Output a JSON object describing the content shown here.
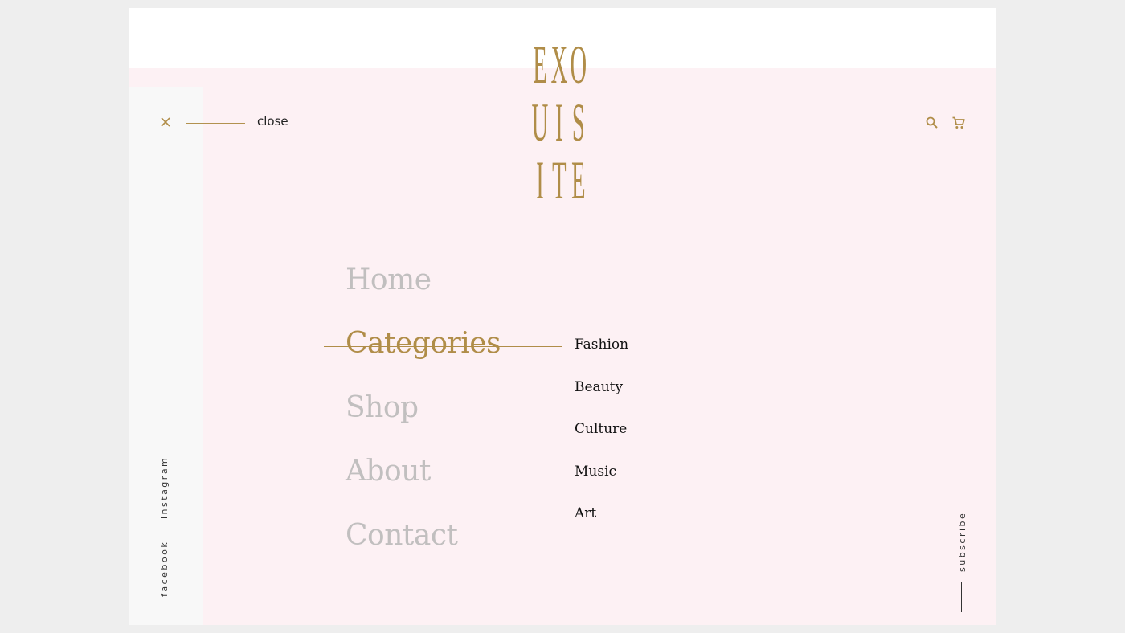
{
  "brand": {
    "logo_rows": [
      [
        "E",
        "X",
        "O"
      ],
      [
        "U",
        "I",
        "S"
      ],
      [
        "I",
        "T",
        "E"
      ]
    ],
    "accent_color": "#b08d48"
  },
  "header": {
    "close_label": "close",
    "icons": {
      "close": "close-icon",
      "search": "search-icon",
      "cart": "cart-icon"
    }
  },
  "menu": {
    "items": [
      {
        "label": "Home",
        "active": false
      },
      {
        "label": "Categories",
        "active": true
      },
      {
        "label": "Shop",
        "active": false
      },
      {
        "label": "About",
        "active": false
      },
      {
        "label": "Contact",
        "active": false
      }
    ],
    "submenu": [
      {
        "label": "Fashion"
      },
      {
        "label": "Beauty"
      },
      {
        "label": "Culture"
      },
      {
        "label": "Music"
      },
      {
        "label": "Art"
      }
    ]
  },
  "social": {
    "instagram": "instagram",
    "facebook": "facebook"
  },
  "footer": {
    "subscribe_label": "subscribe"
  }
}
